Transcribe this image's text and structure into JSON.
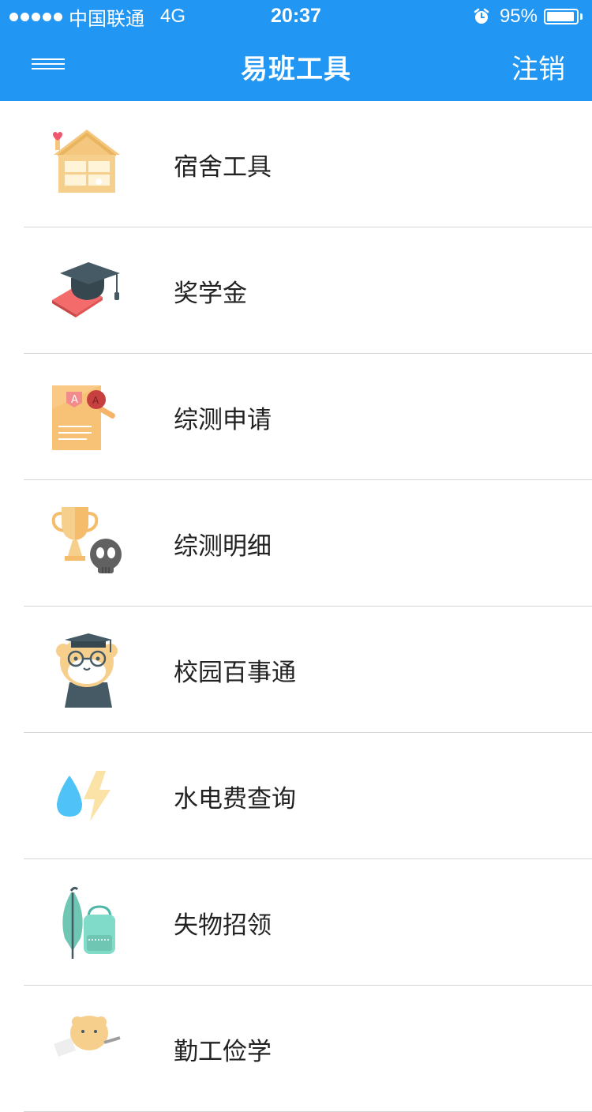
{
  "status_bar": {
    "carrier": "中国联通",
    "network": "4G",
    "time": "20:37",
    "battery": "95%",
    "battery_level": 0.95
  },
  "navbar": {
    "title": "易班工具",
    "right_action": "注销",
    "menu_icon": "hamburger-menu-icon"
  },
  "colors": {
    "primary": "#2196F3",
    "divider": "#d4d4d4",
    "text": "#222222"
  },
  "items": [
    {
      "label": "宿舍工具",
      "icon": "dormitory-house-icon"
    },
    {
      "label": "奖学金",
      "icon": "graduation-cap-book-icon"
    },
    {
      "label": "综测申请",
      "icon": "application-document-icon"
    },
    {
      "label": "综测明细",
      "icon": "trophy-skull-icon"
    },
    {
      "label": "校园百事通",
      "icon": "graduate-mascot-icon"
    },
    {
      "label": "水电费查询",
      "icon": "water-electricity-icon"
    },
    {
      "label": "失物招领",
      "icon": "umbrella-backpack-icon"
    },
    {
      "label": "勤工俭学",
      "icon": "work-study-mascot-icon"
    }
  ]
}
